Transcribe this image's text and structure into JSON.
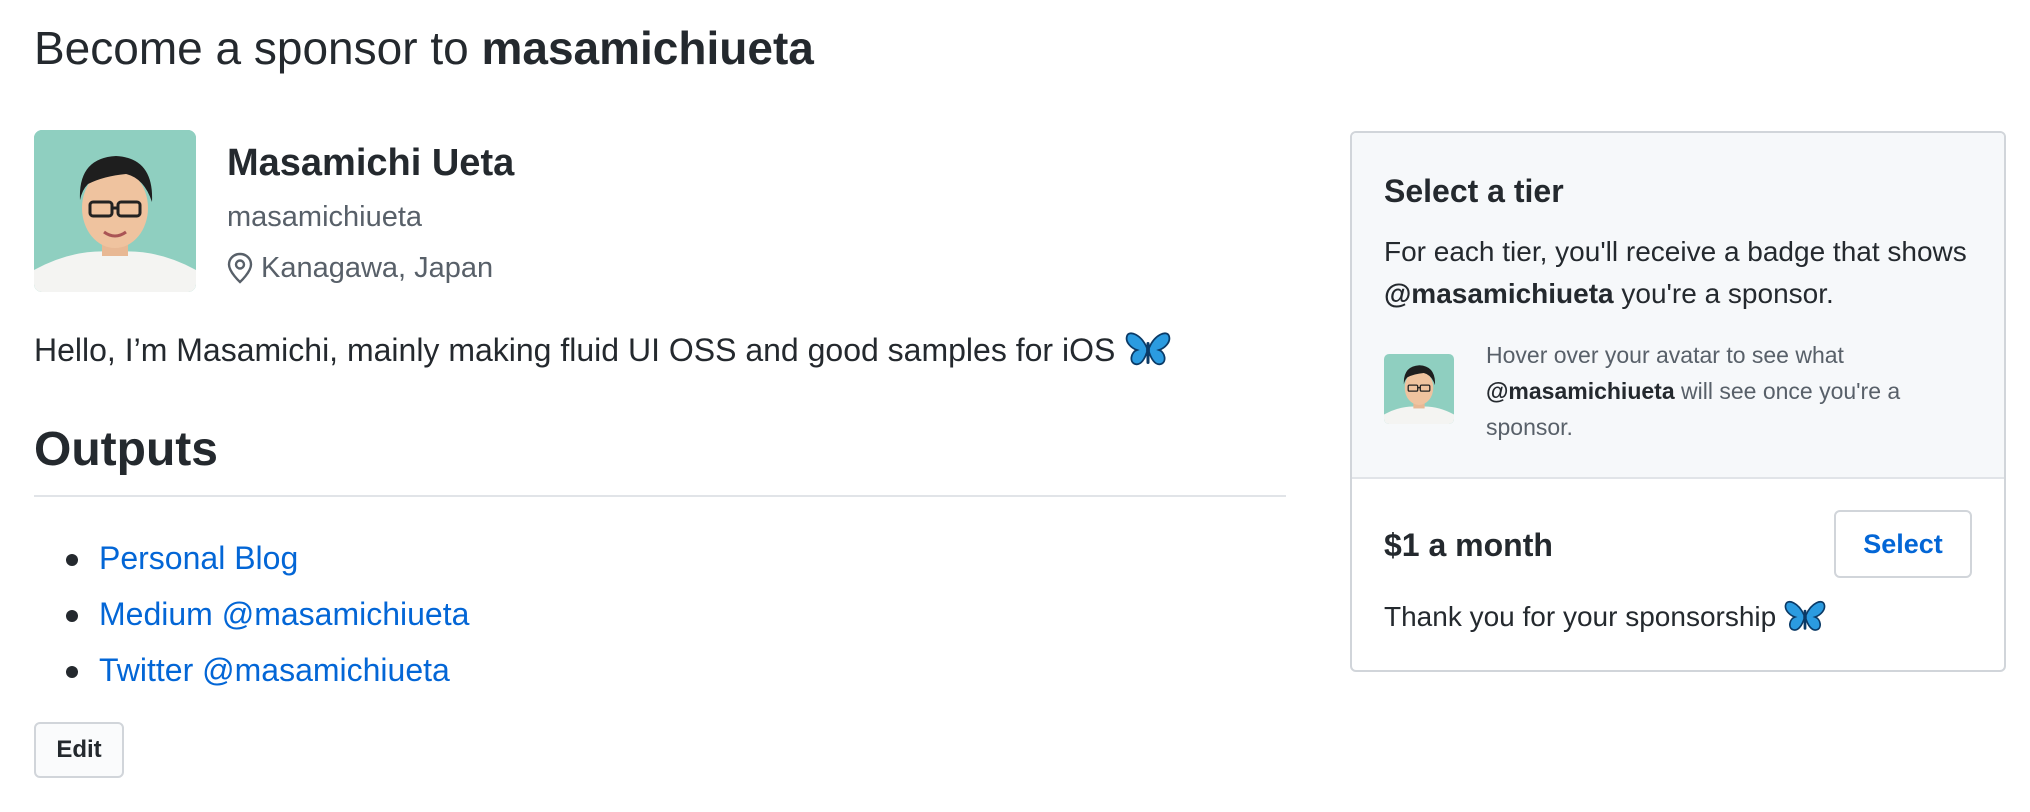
{
  "page": {
    "title_prefix": "Become a sponsor to",
    "title_user": "masamichiueta"
  },
  "profile": {
    "name": "Masamichi Ueta",
    "login": "masamichiueta",
    "location": "Kanagawa, Japan",
    "bio": "Hello, I’m Masamichi, mainly making fluid UI OSS and good samples for iOS"
  },
  "outputs": {
    "heading": "Outputs",
    "links": [
      {
        "label": "Personal Blog"
      },
      {
        "label": "Medium @masamichiueta"
      },
      {
        "label": "Twitter @masamichiueta"
      }
    ]
  },
  "edit_label": "Edit",
  "tier_panel": {
    "title": "Select a tier",
    "desc_before": "For each tier, you'll receive a badge that shows",
    "desc_user": "@masamichiueta",
    "desc_after": "you're a sponsor.",
    "hint_before": "Hover over your avatar to see what",
    "hint_user": "@masamichiueta",
    "hint_after": "will see once you're a sponsor.",
    "tier": {
      "price": "$1 a month",
      "select_label": "Select",
      "description": "Thank you for your sponsorship"
    }
  },
  "icons": {
    "location": "location-pin-icon",
    "butterfly": "butterfly-emoji-icon"
  },
  "colors": {
    "link": "#0366d6",
    "text": "#24292e",
    "muted": "#586069",
    "panel_bg": "#f6f8fa",
    "border": "#d1d5da"
  }
}
